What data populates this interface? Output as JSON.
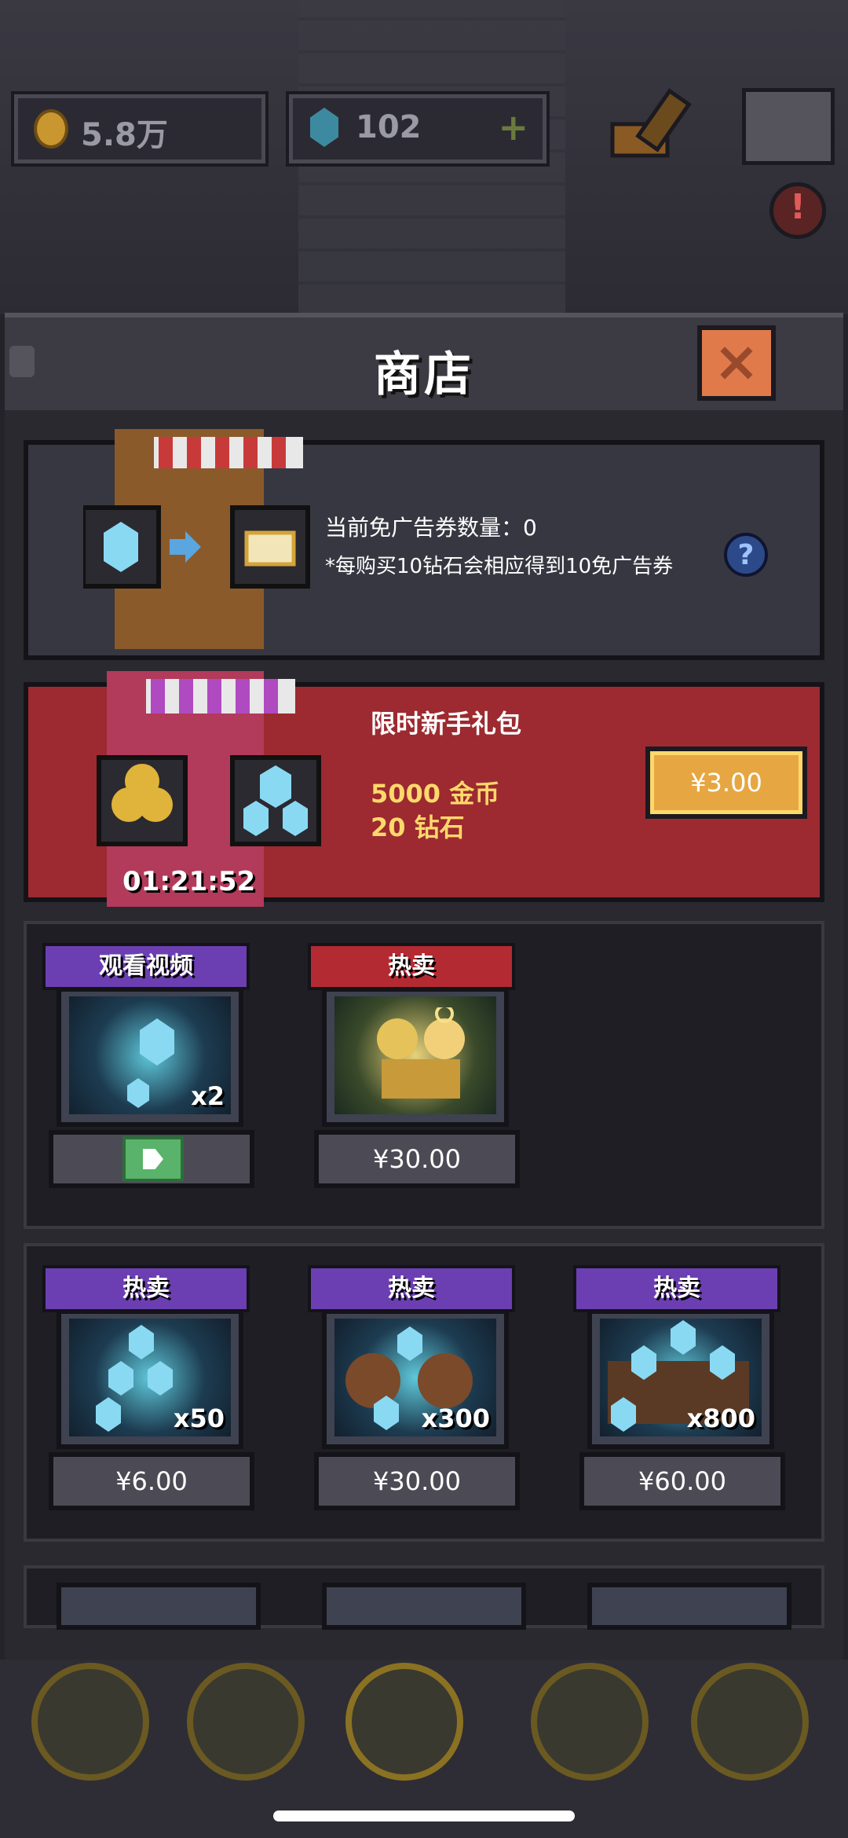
{
  "resources": {
    "gold": "5.8万",
    "gems": "102",
    "add": "+"
  },
  "panel": {
    "title": "商店",
    "close_glyph": "×"
  },
  "ticket": {
    "count_label": "当前免广告券数量：0",
    "note": "*每购买10钻石会相应得到10免广告券",
    "help": "?"
  },
  "starter_pack": {
    "title": "限时新手礼包",
    "gold_line": "5000 金币",
    "gem_line": "20 钻石",
    "price": "¥3.00",
    "timer": "01:21:52"
  },
  "section1": [
    {
      "banner": "观看视频",
      "banner_color": "#6b3fb2",
      "qty": "x2",
      "action": "video"
    },
    {
      "banner": "热卖",
      "banner_color": "#b42a33",
      "price": "¥30.00"
    }
  ],
  "section2": [
    {
      "banner": "热卖",
      "banner_color": "#6b3fb2",
      "qty": "x50",
      "price": "¥6.00"
    },
    {
      "banner": "热卖",
      "banner_color": "#6b3fb2",
      "qty": "x300",
      "price": "¥30.00"
    },
    {
      "banner": "热卖",
      "banner_color": "#6b3fb2",
      "qty": "x800",
      "price": "¥60.00"
    }
  ]
}
